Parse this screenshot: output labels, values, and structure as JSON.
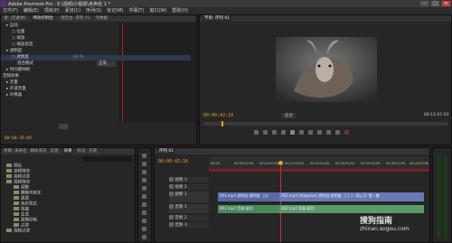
{
  "window": {
    "title": "Adobe Premiere Pro - E:\\视频\\小视频\\未命名 1 *"
  },
  "menu": [
    "文件(F)",
    "编辑(E)",
    "项目(P)",
    "素材(C)",
    "序列(S)",
    "标记(M)",
    "字幕(T)",
    "窗口(W)",
    "帮助(H)"
  ],
  "effect_controls": {
    "tabs": [
      "源: (无素材)",
      "特效控制台",
      "调音台: 序列 01",
      "元数据"
    ],
    "rows": [
      {
        "label": "▸ 运动",
        "indent": 1
      },
      {
        "label": "○ 位置",
        "indent": 2
      },
      {
        "label": "○ 缩放",
        "indent": 2
      },
      {
        "label": "○ 缩放宽度",
        "indent": 2
      },
      {
        "label": "▸ 透明度",
        "indent": 1
      },
      {
        "label": "○ 透明度",
        "indent": 2,
        "value": "63 %"
      },
      {
        "label": "混合模式",
        "indent": 3,
        "value": "正常"
      },
      {
        "label": "▸ 时间重映射",
        "indent": 1
      },
      {
        "label": "音频效果",
        "indent": 0
      },
      {
        "label": "▸ 音量",
        "indent": 1
      },
      {
        "label": "▸ 声道音量",
        "indent": 1
      },
      {
        "label": "▸ 声像器",
        "indent": 1
      }
    ],
    "current_time": "00:00:38:09",
    "bottom_time": "00:00:38:09"
  },
  "program_monitor": {
    "tab": "节目: 序列 01",
    "current_time": "00:00:42:10",
    "fit": "适合",
    "duration": "00:11:01:03"
  },
  "project_panel": {
    "tabs": [
      "项目: 未命名",
      "媒体浏览",
      "信息",
      "效果",
      "标记",
      "历史"
    ],
    "items": [
      "预设",
      "音频特效",
      "音频过渡",
      "视频特效",
      "调整",
      "模糊与锐化",
      "通道",
      "色彩校正",
      "扭曲",
      "生成",
      "图像控制",
      "过渡",
      "视频过渡"
    ]
  },
  "timeline": {
    "tab": "序列 01",
    "current_time": "00:00:42:10",
    "ruler_ticks": [
      "00:00",
      "00:05:00:00",
      "00:10:00:00",
      "00:15:00:00",
      "00:20:00:00",
      "00:25:00:00",
      "00:30:00:00",
      "00:35:00:00",
      "00:40:00:00"
    ],
    "tracks": [
      "视频 3",
      "视频 2",
      "视频 1",
      "音频 1",
      "音频 2",
      "音频 3"
    ],
    "clips": {
      "v1a": "001.mp4 透明度:透明度 · [a]",
      "v1b": "002.mp4 [Adaptive] 透明度:透明度 · [ 1 ] 《Ep.2》第一集",
      "a1a": "001.mp4 音量:级别",
      "a1b": "002.mp4 音量:级别"
    }
  },
  "watermark": {
    "text": "搜狗指南",
    "url": "zhinan.sogou.com"
  }
}
